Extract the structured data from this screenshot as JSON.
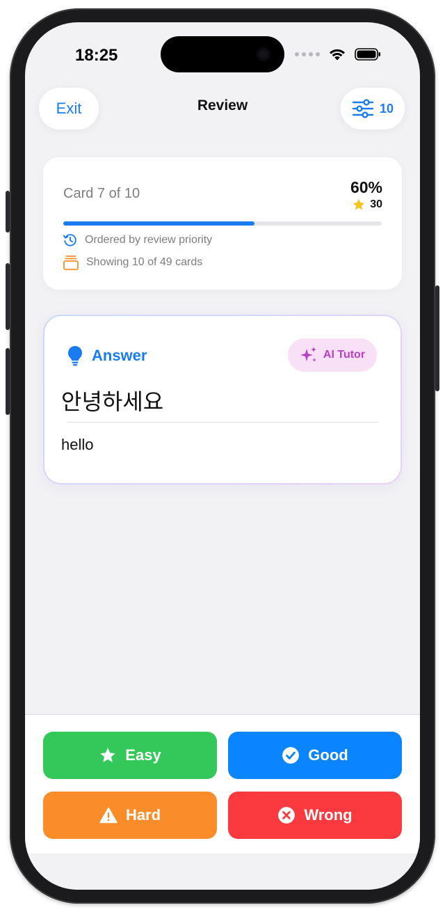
{
  "status": {
    "time": "18:25"
  },
  "nav": {
    "exit_label": "Exit",
    "title": "Review",
    "filter_count": "10"
  },
  "progress": {
    "card_label": "Card 7 of 10",
    "percent_label": "60%",
    "stars": "30",
    "fill_fraction": 0.6,
    "order_info": "Ordered by review priority",
    "showing_info": "Showing 10 of 49 cards"
  },
  "answer": {
    "label": "Answer",
    "ai_tutor_label": "AI Tutor",
    "term": "안녕하세요",
    "meaning": "hello"
  },
  "grades": {
    "easy": "Easy",
    "good": "Good",
    "hard": "Hard",
    "wrong": "Wrong"
  },
  "colors": {
    "accent": "#1a7cf0",
    "easy": "#34c759",
    "good": "#0a84ff",
    "hard": "#fb8c2a",
    "wrong": "#fb3a3f",
    "ai_tutor": "#b93fc6",
    "star": "#f7c21a"
  },
  "icons": {
    "exit": "none",
    "filter": "sliders-icon",
    "order": "clock-history-icon",
    "showing": "card-stack-icon",
    "answer": "lightbulb-icon",
    "ai_tutor": "sparkles-icon",
    "easy": "star-icon",
    "good": "checkmark-circle-icon",
    "hard": "warning-triangle-icon",
    "wrong": "x-circle-icon"
  }
}
